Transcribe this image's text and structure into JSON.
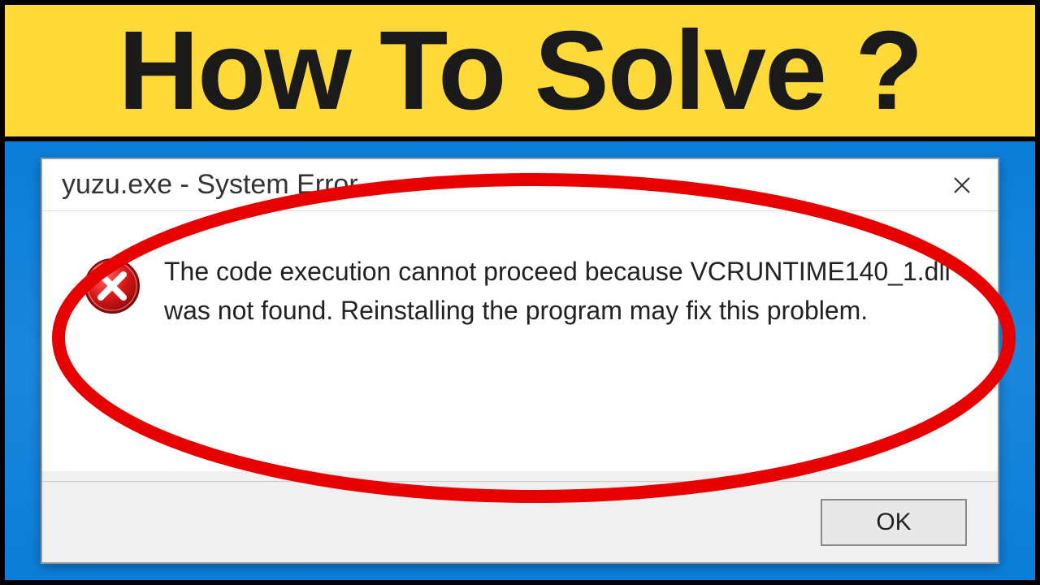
{
  "banner": {
    "title": "How To Solve ?"
  },
  "dialog": {
    "title": "yuzu.exe - System Error",
    "message": "The code execution cannot proceed because VCRUNTIME140_1.dll was not found. Reinstalling the program may fix this problem.",
    "ok_label": "OK"
  },
  "colors": {
    "banner_bg": "#ffd938",
    "desktop_bg": "#0a7dd8",
    "highlight": "#e60000"
  }
}
